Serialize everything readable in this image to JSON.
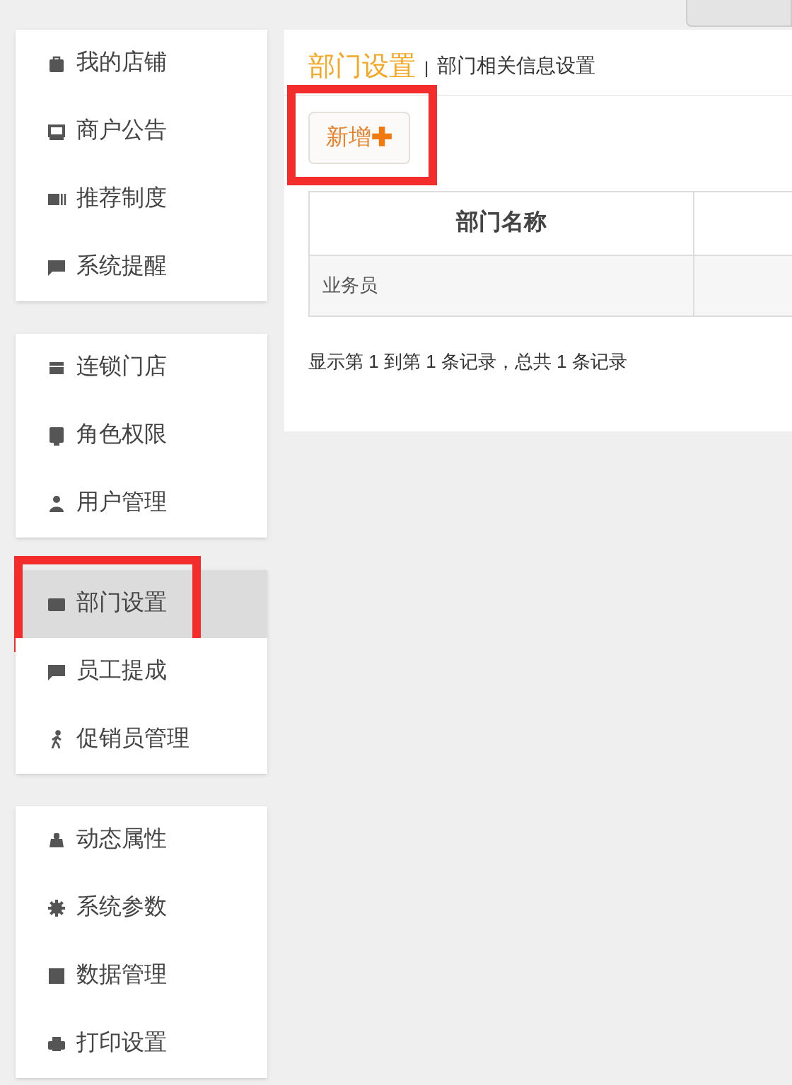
{
  "sidebar": {
    "groups": [
      {
        "items": [
          {
            "label": "我的店铺",
            "selected": false,
            "highlighted": false
          },
          {
            "label": "商户公告",
            "selected": false,
            "highlighted": false
          },
          {
            "label": "推荐制度",
            "selected": false,
            "highlighted": false
          },
          {
            "label": "系统提醒",
            "selected": false,
            "highlighted": false
          }
        ]
      },
      {
        "items": [
          {
            "label": "连锁门店",
            "selected": false,
            "highlighted": false
          },
          {
            "label": "角色权限",
            "selected": false,
            "highlighted": false
          },
          {
            "label": "用户管理",
            "selected": false,
            "highlighted": false
          }
        ]
      },
      {
        "items": [
          {
            "label": "部门设置",
            "selected": true,
            "highlighted": true
          },
          {
            "label": "员工提成",
            "selected": false,
            "highlighted": false
          },
          {
            "label": "促销员管理",
            "selected": false,
            "highlighted": false
          }
        ]
      },
      {
        "items": [
          {
            "label": "动态属性",
            "selected": false,
            "highlighted": false
          },
          {
            "label": "系统参数",
            "selected": false,
            "highlighted": false
          },
          {
            "label": "数据管理",
            "selected": false,
            "highlighted": false
          },
          {
            "label": "打印设置",
            "selected": false,
            "highlighted": false
          }
        ]
      }
    ]
  },
  "main": {
    "title": "部门设置",
    "separator": "|",
    "subtitle": "部门相关信息设置",
    "add_button": {
      "label": "新增",
      "icon_text": "✚",
      "highlighted": true
    },
    "table": {
      "columns": [
        "部门名称"
      ],
      "rows": [
        [
          "业务员"
        ]
      ]
    },
    "footer": "显示第 1 到第 1 条记录，总共 1 条记录"
  }
}
